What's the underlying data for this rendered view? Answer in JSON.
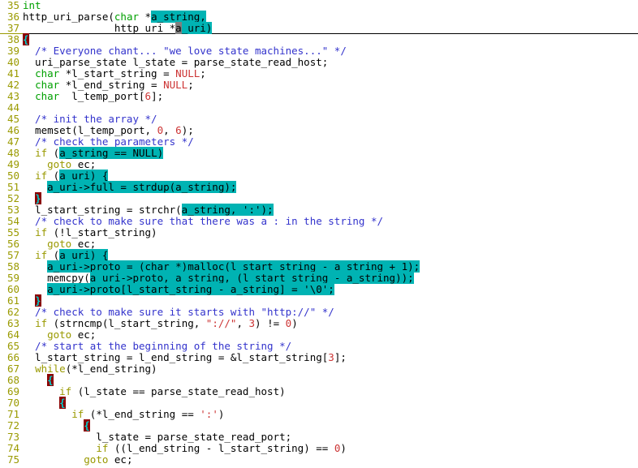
{
  "editor": {
    "theme_colors": {
      "background": "#ffffff",
      "foreground": "#000000",
      "line_number": "#9a9a00",
      "keyword_type": "#00a000",
      "keyword_statement": "#999900",
      "comment": "#3333cc",
      "constant": "#cc3333",
      "string": "#cc3333",
      "search_highlight_bg": "#00b3b3",
      "matching_brace_bg": "#8b0000",
      "matching_brace_fg": "#00d0d0",
      "cursor_bg": "#808080",
      "separator_rule": "#000000"
    },
    "language": "c",
    "first_visible_line": 35,
    "last_visible_line": 75,
    "cursor": {
      "line": 37,
      "column": 21,
      "char": "a"
    },
    "search_term": "a_uri",
    "lines": [
      {
        "number": "35",
        "tokens": [
          {
            "text": "int",
            "cls": "t-kw"
          }
        ]
      },
      {
        "number": "36",
        "tokens": [
          {
            "text": "http_uri_parse(",
            "cls": "t-plain"
          },
          {
            "text": "char",
            "cls": "t-kw"
          },
          {
            "text": " *",
            "cls": "t-plain"
          },
          {
            "text": "a_string,",
            "cls": "t-plain",
            "hl": true
          }
        ]
      },
      {
        "number": "37",
        "separator": true,
        "tokens": [
          {
            "text": "               http_uri *",
            "cls": "t-plain"
          },
          {
            "text": "a",
            "cls": "t-plain",
            "cursor": true
          },
          {
            "text": "_uri)",
            "cls": "t-plain",
            "hl": true
          }
        ]
      },
      {
        "number": "38",
        "tokens": [
          {
            "text": "{",
            "cls": "t-plain",
            "brace": true
          }
        ]
      },
      {
        "number": "39",
        "tokens": [
          {
            "text": "  /* Everyone chant... \"we love state machines...\" */",
            "cls": "t-cmt"
          }
        ]
      },
      {
        "number": "40",
        "tokens": [
          {
            "text": "  uri_parse_state l_state = parse_state_read_host;",
            "cls": "t-plain"
          }
        ]
      },
      {
        "number": "41",
        "tokens": [
          {
            "text": "  ",
            "cls": "t-plain"
          },
          {
            "text": "char",
            "cls": "t-kw"
          },
          {
            "text": " *l_start_string = ",
            "cls": "t-plain"
          },
          {
            "text": "NULL",
            "cls": "t-con"
          },
          {
            "text": ";",
            "cls": "t-plain"
          }
        ]
      },
      {
        "number": "42",
        "tokens": [
          {
            "text": "  ",
            "cls": "t-plain"
          },
          {
            "text": "char",
            "cls": "t-kw"
          },
          {
            "text": " *l_end_string = ",
            "cls": "t-plain"
          },
          {
            "text": "NULL",
            "cls": "t-con"
          },
          {
            "text": ";",
            "cls": "t-plain"
          }
        ]
      },
      {
        "number": "43",
        "tokens": [
          {
            "text": "  ",
            "cls": "t-plain"
          },
          {
            "text": "char",
            "cls": "t-kw"
          },
          {
            "text": "  l_temp_port[",
            "cls": "t-plain"
          },
          {
            "text": "6",
            "cls": "t-num"
          },
          {
            "text": "];",
            "cls": "t-plain"
          }
        ]
      },
      {
        "number": "44",
        "tokens": []
      },
      {
        "number": "45",
        "tokens": [
          {
            "text": "  /* init the array */",
            "cls": "t-cmt"
          }
        ]
      },
      {
        "number": "46",
        "tokens": [
          {
            "text": "  memset(l_temp_port, ",
            "cls": "t-plain"
          },
          {
            "text": "0",
            "cls": "t-num"
          },
          {
            "text": ", ",
            "cls": "t-plain"
          },
          {
            "text": "6",
            "cls": "t-num"
          },
          {
            "text": ");",
            "cls": "t-plain"
          }
        ]
      },
      {
        "number": "47",
        "tokens": [
          {
            "text": "  /* check the parameters */",
            "cls": "t-cmt"
          }
        ]
      },
      {
        "number": "48",
        "tokens": [
          {
            "text": "  ",
            "cls": "t-plain"
          },
          {
            "text": "if",
            "cls": "t-stmt"
          },
          {
            "text": " (",
            "cls": "t-plain"
          },
          {
            "text": "a_string == NULL)",
            "cls": "t-plain",
            "hl": true
          }
        ]
      },
      {
        "number": "49",
        "tokens": [
          {
            "text": "    ",
            "cls": "t-plain"
          },
          {
            "text": "goto",
            "cls": "t-stmt"
          },
          {
            "text": " ec;",
            "cls": "t-plain"
          }
        ]
      },
      {
        "number": "50",
        "tokens": [
          {
            "text": "  ",
            "cls": "t-plain"
          },
          {
            "text": "if",
            "cls": "t-stmt"
          },
          {
            "text": " (",
            "cls": "t-plain"
          },
          {
            "text": "a_uri) {",
            "cls": "t-plain",
            "hl": true
          }
        ]
      },
      {
        "number": "51",
        "tokens": [
          {
            "text": "    ",
            "cls": "t-plain"
          },
          {
            "text": "a_uri->full = strdup(a_string);",
            "cls": "t-plain",
            "hl": true
          }
        ]
      },
      {
        "number": "52",
        "tokens": [
          {
            "text": "  ",
            "cls": "t-plain"
          },
          {
            "text": "}",
            "cls": "t-plain",
            "brace": true
          }
        ]
      },
      {
        "number": "53",
        "tokens": [
          {
            "text": "  l_start_string = strchr(",
            "cls": "t-plain"
          },
          {
            "text": "a_string, ':');",
            "cls": "t-plain",
            "hl": true
          }
        ]
      },
      {
        "number": "54",
        "tokens": [
          {
            "text": "  /* check to make sure that there was a : in the string */",
            "cls": "t-cmt"
          }
        ]
      },
      {
        "number": "55",
        "tokens": [
          {
            "text": "  ",
            "cls": "t-plain"
          },
          {
            "text": "if",
            "cls": "t-stmt"
          },
          {
            "text": " (!l_start_string)",
            "cls": "t-plain"
          }
        ]
      },
      {
        "number": "56",
        "tokens": [
          {
            "text": "    ",
            "cls": "t-plain"
          },
          {
            "text": "goto",
            "cls": "t-stmt"
          },
          {
            "text": " ec;",
            "cls": "t-plain"
          }
        ]
      },
      {
        "number": "57",
        "tokens": [
          {
            "text": "  ",
            "cls": "t-plain"
          },
          {
            "text": "if",
            "cls": "t-stmt"
          },
          {
            "text": " (",
            "cls": "t-plain"
          },
          {
            "text": "a_uri) {",
            "cls": "t-plain",
            "hl": true
          }
        ]
      },
      {
        "number": "58",
        "tokens": [
          {
            "text": "    ",
            "cls": "t-plain"
          },
          {
            "text": "a_uri->proto = (char *)malloc(l_start_string - a_string + 1);",
            "cls": "t-plain",
            "hl": true
          }
        ]
      },
      {
        "number": "59",
        "tokens": [
          {
            "text": "    memcpy(",
            "cls": "t-plain"
          },
          {
            "text": "a_uri->proto, a_string, (l_start_string - a_string));",
            "cls": "t-plain",
            "hl": true
          }
        ]
      },
      {
        "number": "60",
        "tokens": [
          {
            "text": "    ",
            "cls": "t-plain"
          },
          {
            "text": "a_uri->proto[l_start_string - a_string] = '\\0';",
            "cls": "t-plain",
            "hl": true
          }
        ]
      },
      {
        "number": "61",
        "tokens": [
          {
            "text": "  ",
            "cls": "t-plain"
          },
          {
            "text": "}",
            "cls": "t-plain",
            "brace": true
          }
        ]
      },
      {
        "number": "62",
        "tokens": [
          {
            "text": "  /* check to make sure it starts with \"http://\" */",
            "cls": "t-cmt"
          }
        ]
      },
      {
        "number": "63",
        "tokens": [
          {
            "text": "  ",
            "cls": "t-plain"
          },
          {
            "text": "if",
            "cls": "t-stmt"
          },
          {
            "text": " (strncmp(l_start_string, ",
            "cls": "t-plain"
          },
          {
            "text": "\"://\"",
            "cls": "t-str"
          },
          {
            "text": ", ",
            "cls": "t-plain"
          },
          {
            "text": "3",
            "cls": "t-num"
          },
          {
            "text": ") != ",
            "cls": "t-plain"
          },
          {
            "text": "0",
            "cls": "t-num"
          },
          {
            "text": ")",
            "cls": "t-plain"
          }
        ]
      },
      {
        "number": "64",
        "tokens": [
          {
            "text": "    ",
            "cls": "t-plain"
          },
          {
            "text": "goto",
            "cls": "t-stmt"
          },
          {
            "text": " ec;",
            "cls": "t-plain"
          }
        ]
      },
      {
        "number": "65",
        "tokens": [
          {
            "text": "  /* start at the beginning of the string */",
            "cls": "t-cmt"
          }
        ]
      },
      {
        "number": "66",
        "tokens": [
          {
            "text": "  l_start_string = l_end_string = &l_start_string[",
            "cls": "t-plain"
          },
          {
            "text": "3",
            "cls": "t-num"
          },
          {
            "text": "];",
            "cls": "t-plain"
          }
        ]
      },
      {
        "number": "67",
        "tokens": [
          {
            "text": "  ",
            "cls": "t-plain"
          },
          {
            "text": "while",
            "cls": "t-stmt"
          },
          {
            "text": "(*l_end_string)",
            "cls": "t-plain"
          }
        ]
      },
      {
        "number": "68",
        "tokens": [
          {
            "text": "    ",
            "cls": "t-plain"
          },
          {
            "text": "{",
            "cls": "t-plain",
            "brace": true
          }
        ]
      },
      {
        "number": "69",
        "tokens": [
          {
            "text": "      ",
            "cls": "t-plain"
          },
          {
            "text": "if",
            "cls": "t-stmt"
          },
          {
            "text": " (l_state == parse_state_read_host)",
            "cls": "t-plain"
          }
        ]
      },
      {
        "number": "70",
        "tokens": [
          {
            "text": "      ",
            "cls": "t-plain"
          },
          {
            "text": "{",
            "cls": "t-plain",
            "brace": true
          }
        ]
      },
      {
        "number": "71",
        "tokens": [
          {
            "text": "        ",
            "cls": "t-plain"
          },
          {
            "text": "if",
            "cls": "t-stmt"
          },
          {
            "text": " (*l_end_string == ",
            "cls": "t-plain"
          },
          {
            "text": "':'",
            "cls": "t-str"
          },
          {
            "text": ")",
            "cls": "t-plain"
          }
        ]
      },
      {
        "number": "72",
        "tokens": [
          {
            "text": "          ",
            "cls": "t-plain"
          },
          {
            "text": "{",
            "cls": "t-plain",
            "brace": true
          }
        ]
      },
      {
        "number": "73",
        "tokens": [
          {
            "text": "            l_state = parse_state_read_port;",
            "cls": "t-plain"
          }
        ]
      },
      {
        "number": "74",
        "tokens": [
          {
            "text": "            ",
            "cls": "t-plain"
          },
          {
            "text": "if",
            "cls": "t-stmt"
          },
          {
            "text": " ((l_end_string - l_start_string) == ",
            "cls": "t-plain"
          },
          {
            "text": "0",
            "cls": "t-num"
          },
          {
            "text": ")",
            "cls": "t-plain"
          }
        ]
      },
      {
        "number": "75",
        "tokens": [
          {
            "text": "          ",
            "cls": "t-plain"
          },
          {
            "text": "goto",
            "cls": "t-stmt"
          },
          {
            "text": " ec;",
            "cls": "t-plain"
          }
        ]
      }
    ]
  }
}
